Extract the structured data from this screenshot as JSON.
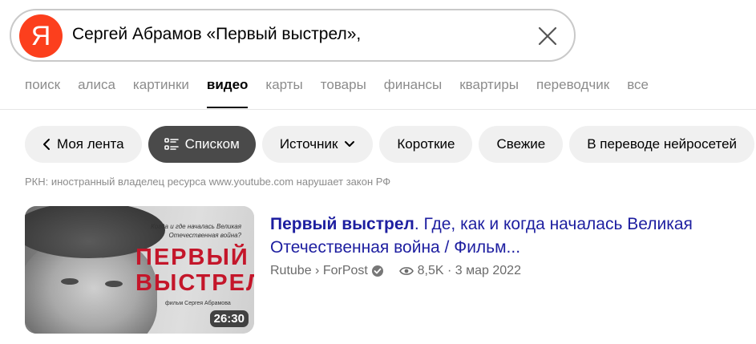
{
  "search": {
    "logo_letter": "Я",
    "query": "Сергей Абрамов «Первый выстрел»,"
  },
  "tabs": [
    {
      "label": "поиск",
      "active": false
    },
    {
      "label": "алиса",
      "active": false
    },
    {
      "label": "картинки",
      "active": false
    },
    {
      "label": "видео",
      "active": true
    },
    {
      "label": "карты",
      "active": false
    },
    {
      "label": "товары",
      "active": false
    },
    {
      "label": "финансы",
      "active": false
    },
    {
      "label": "квартиры",
      "active": false
    },
    {
      "label": "переводчик",
      "active": false
    },
    {
      "label": "все",
      "active": false
    }
  ],
  "chips": {
    "feed": "Моя лента",
    "list": "Списком",
    "source": "Источник",
    "short": "Короткие",
    "fresh": "Свежие",
    "translated": "В переводе нейросетей"
  },
  "warning": "РКН: иностранный владелец ресурса www.youtube.com нарушает закон РФ",
  "result": {
    "thumbnail": {
      "subtitle": "Когда и где началась Великая Отечественная война?",
      "title": "ПЕРВЫЙ\nВЫСТРЕЛ",
      "credit": "фильм Сергея Абрамова",
      "duration": "26:30"
    },
    "title_bold": "Первый выстрел",
    "title_rest": ". Где, как и когда началась Великая Отечественная война / Фильм...",
    "source": "Rutube › ForPost",
    "views": "8,5K",
    "separator": "·",
    "date": "3 мар 2022"
  },
  "colors": {
    "brand": "#fc3f1d",
    "link": "#1d1ea0",
    "thumb_title": "#c4162a"
  }
}
